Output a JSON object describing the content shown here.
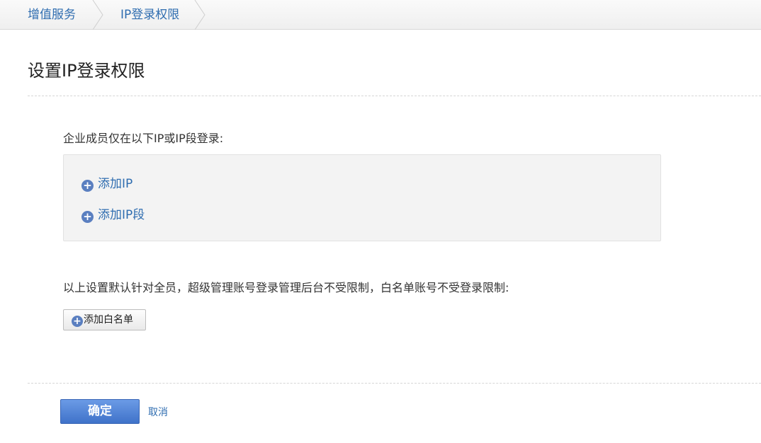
{
  "breadcrumb": {
    "items": [
      {
        "label": "增值服务"
      },
      {
        "label": "IP登录权限"
      }
    ]
  },
  "page": {
    "title": "设置IP登录权限"
  },
  "ip_section": {
    "label": "企业成员仅在以下IP或IP段登录:",
    "add_ip_label": "添加IP",
    "add_ip_range_label": "添加IP段"
  },
  "whitelist": {
    "note": "以上设置默认针对全员，超级管理账号登录管理后台不受限制，白名单账号不受登录限制:",
    "add_button_label": "添加白名单"
  },
  "actions": {
    "confirm_label": "确定",
    "cancel_label": "取消"
  },
  "colors": {
    "link": "#2f6db0",
    "primary_button": "#4a7fd6",
    "plus_icon": "#5a7fc0"
  }
}
